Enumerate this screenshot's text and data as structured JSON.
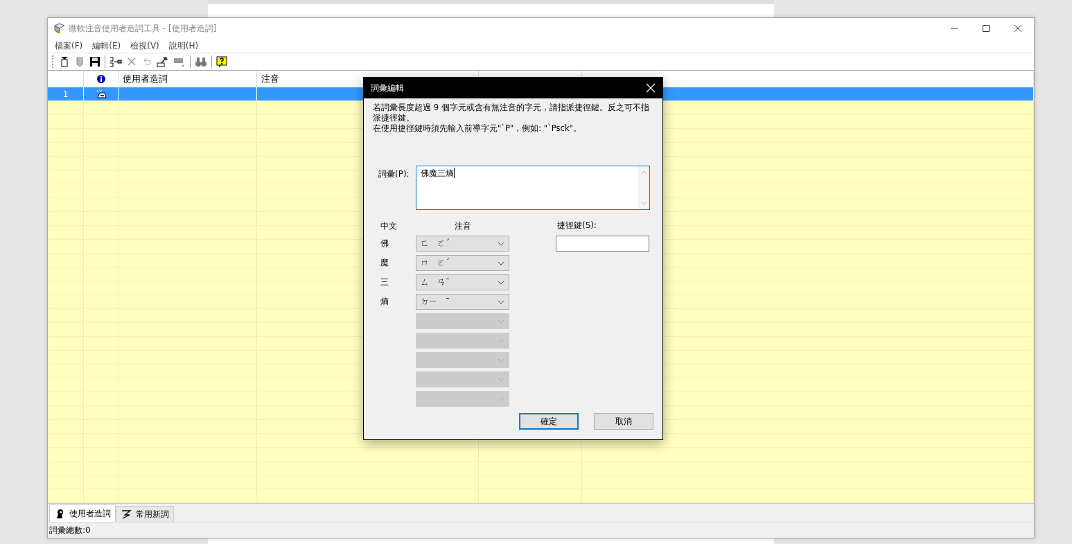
{
  "window": {
    "title": "微軟注音使用者造詞工具 - [使用者造詞]"
  },
  "menu": [
    {
      "label": "檔案(F)"
    },
    {
      "label": "編輯(E)"
    },
    {
      "label": "檢視(V)"
    },
    {
      "label": "說明(H)"
    }
  ],
  "table": {
    "columns": [
      "使用者造詞",
      "注音"
    ],
    "rows": [
      {
        "number": "1",
        "selected": true
      }
    ]
  },
  "dialog": {
    "title": "詞彙編輯",
    "message": [
      "若詞彙長度超過 9 個字元或含有無注音的字元，請指派捷徑鍵。反之可不指派捷徑鍵。",
      "在使用捷徑鍵時須先輸入前導字元\"`P\"，例如: \"`Psck\"。"
    ],
    "phrase_label": "詞彙(P):",
    "phrase_value": "佛魔三熵",
    "char_header": "中文",
    "reading_header": "注音",
    "shortcut_label": "捷徑鍵(S):",
    "readings": [
      {
        "char": "佛",
        "reading": "ㄈ　ㄛˊ",
        "disabled": false
      },
      {
        "char": "魔",
        "reading": "ㄇ　ㄛˊ",
        "disabled": false
      },
      {
        "char": "三",
        "reading": "ㄙ　ㄢˉ",
        "disabled": false
      },
      {
        "char": "熵",
        "reading": "ㄉㄧ　ˉ",
        "disabled": false
      },
      {
        "disabled": true
      },
      {
        "disabled": true
      },
      {
        "disabled": true
      },
      {
        "disabled": true
      },
      {
        "disabled": true
      }
    ],
    "buttons": [
      {
        "label": "確定",
        "default": true
      },
      {
        "label": "取消",
        "default": false
      }
    ]
  },
  "tabs": [
    {
      "label": "使用者造詞",
      "selected": true
    },
    {
      "label": "常用新詞",
      "selected": false
    }
  ],
  "status_bar": "詞彙總數:0"
}
